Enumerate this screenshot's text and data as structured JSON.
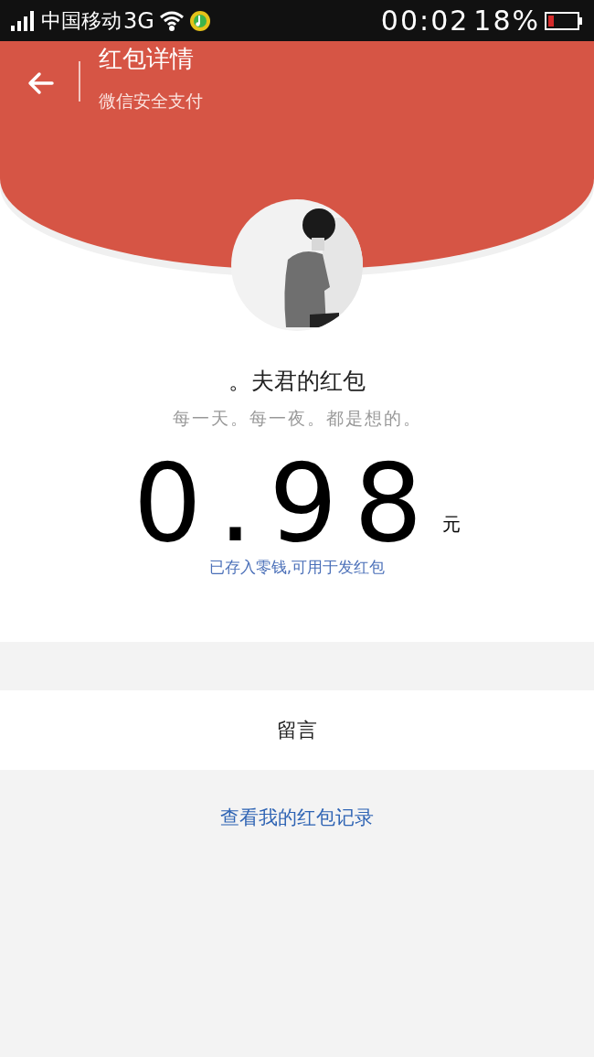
{
  "status_bar": {
    "carrier": "中国移动",
    "network": "3G",
    "time": "00:02",
    "battery": "18%"
  },
  "header": {
    "title": "红包详情",
    "subtitle": "微信安全支付"
  },
  "sender": {
    "name": "。夫君的红包",
    "message": "每一天。每一夜。都是想的。"
  },
  "amount": {
    "value": "0.98",
    "unit": "元",
    "note": "已存入零钱,可用于发红包"
  },
  "comment_button": "留言",
  "history_link": "查看我的红包记录"
}
